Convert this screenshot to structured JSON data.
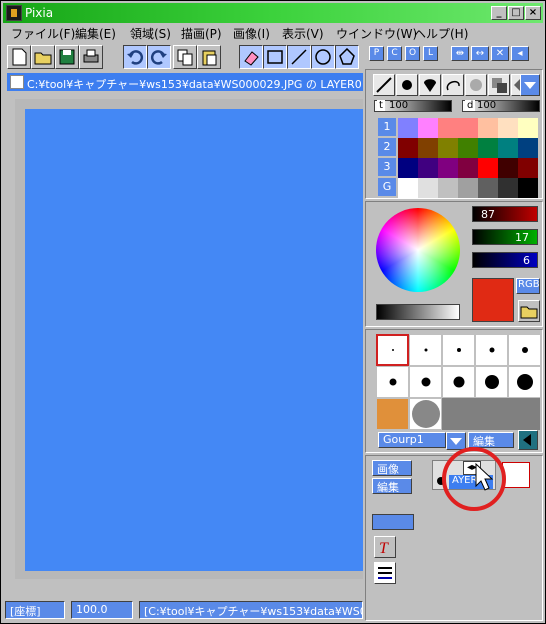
{
  "window": {
    "title": "Pixia",
    "min": "_",
    "max": "□",
    "close": "×"
  },
  "menu": [
    "ファイル(F)",
    "編集(E)",
    "領域(S)",
    "描画(P)",
    "画像(I)",
    "表示(V)",
    "ウインドウ(W)",
    "ヘルプ(H)"
  ],
  "toolbar": {
    "icons": [
      "new-file-icon",
      "open-folder-icon",
      "save-icon",
      "print-icon",
      "undo-icon",
      "redo-icon",
      "copy-icon",
      "paste-icon",
      "eraser-icon",
      "rectangle-icon",
      "line-icon",
      "circle-icon",
      "polygon-icon"
    ]
  },
  "panel_tabs": [
    "P",
    "C",
    "O",
    "L"
  ],
  "document": {
    "title": "C:¥tool¥キャプチャー¥ws153¥data¥WS000029.JPG の LAYER0 [標準",
    "canvas_color": "#4488f5"
  },
  "status": {
    "coords_label": "[座標]",
    "zoom": "100.0",
    "path": "[C:¥tool¥キャプチャー¥ws153¥data¥WS0"
  },
  "palette": {
    "t_label": "t",
    "t_value": "100",
    "d_label": "d",
    "d_value": "100",
    "row_labels": [
      "1",
      "2",
      "3",
      "G"
    ],
    "rows": [
      [
        "#8080ff",
        "#ff80ff",
        "#ff8080",
        "#ff8080",
        "#ffc0a0",
        "#ffe0c0",
        "#ffffc0"
      ],
      [
        "#800000",
        "#804000",
        "#808000",
        "#408000",
        "#008040",
        "#008080",
        "#004080"
      ],
      [
        "#000080",
        "#400080",
        "#800080",
        "#800040",
        "#ff0000",
        "#400000",
        "#800000"
      ],
      [
        "#ffffff",
        "#e0e0e0",
        "#c0c0c0",
        "#a0a0a0",
        "#606060",
        "#303030",
        "#000000"
      ]
    ]
  },
  "color": {
    "r": "87",
    "g": "17",
    "b": "6",
    "mode": "RGB",
    "current": "#e02a14"
  },
  "brush": {
    "group": "Gourp1",
    "edit_label": "編集"
  },
  "layer": {
    "image_label": "画像",
    "edit_label": "編集",
    "layer_name": "AYER"
  }
}
